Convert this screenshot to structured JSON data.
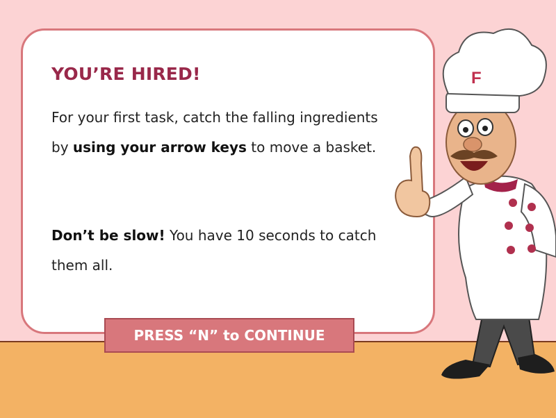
{
  "dialog": {
    "title": "YOU’RE HIRED!",
    "p1_pre": "For your first task, catch the falling ingredients by ",
    "p1_bold": "using your arrow keys",
    "p1_post": " to move a basket.",
    "p2_bold": "Don’t be slow!",
    "p2_post": " You have 10 seconds to catch them all."
  },
  "continue_button": {
    "label": "PRESS “N” to CONTINUE"
  },
  "chef": {
    "hat_letter": "F"
  },
  "colors": {
    "background": "#fcd3d4",
    "floor": "#f3b264",
    "accent": "#d8777c",
    "title": "#99284a"
  }
}
